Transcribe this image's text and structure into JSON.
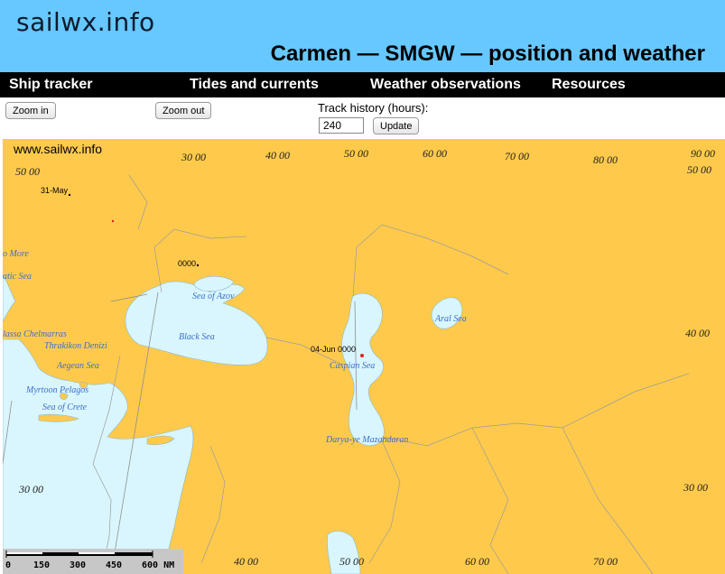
{
  "header": {
    "logo": "sailwx.info",
    "title": "Carmen — SMGW — position and weather",
    "background": "#66c8ff"
  },
  "nav": {
    "items": [
      "Ship tracker",
      "Tides and currents",
      "Weather observations",
      "Resources"
    ]
  },
  "controls": {
    "zoom_in": "Zoom in",
    "zoom_out": "Zoom out",
    "track_label": "Track history (hours):",
    "track_value": "240",
    "update": "Update"
  },
  "map": {
    "watermark": "www.sailwx.info",
    "land_color": "#ffca4c",
    "water_color": "#d9f6ff",
    "grid_labels": {
      "lon_top": [
        "30 00",
        "40 00",
        "50 00",
        "60 00",
        "70 00",
        "80 00",
        "90 00"
      ],
      "lon_bottom": [
        "40 00",
        "50 00",
        "60 00",
        "70 00"
      ],
      "lat_left": [
        "50 00",
        "30 00"
      ],
      "lat_right": [
        "50 00",
        "40 00",
        "30 00"
      ]
    },
    "seas": {
      "more": "o More",
      "atic": "atic Sea",
      "azov": "Sea of Azov",
      "aral": "Aral Sea",
      "chelmarras": "lassa Chelmarras",
      "thrakikon": "Thrakikon Denizi",
      "black": "Black Sea",
      "caspian": "Caspian Sea",
      "aegean": "Aegean Sea",
      "myrtoon": "Myrtoon Pelagos",
      "crete": "Sea of Crete",
      "mazandaran": "Darya-ye Mazandaran"
    },
    "track": {
      "point1": "31-May",
      "point2": "0000",
      "point3": "04-Jun 0000",
      "dot_color": "#e02020"
    },
    "scale": {
      "labels": [
        "0",
        "150",
        "300",
        "450",
        "600 NM"
      ]
    }
  }
}
